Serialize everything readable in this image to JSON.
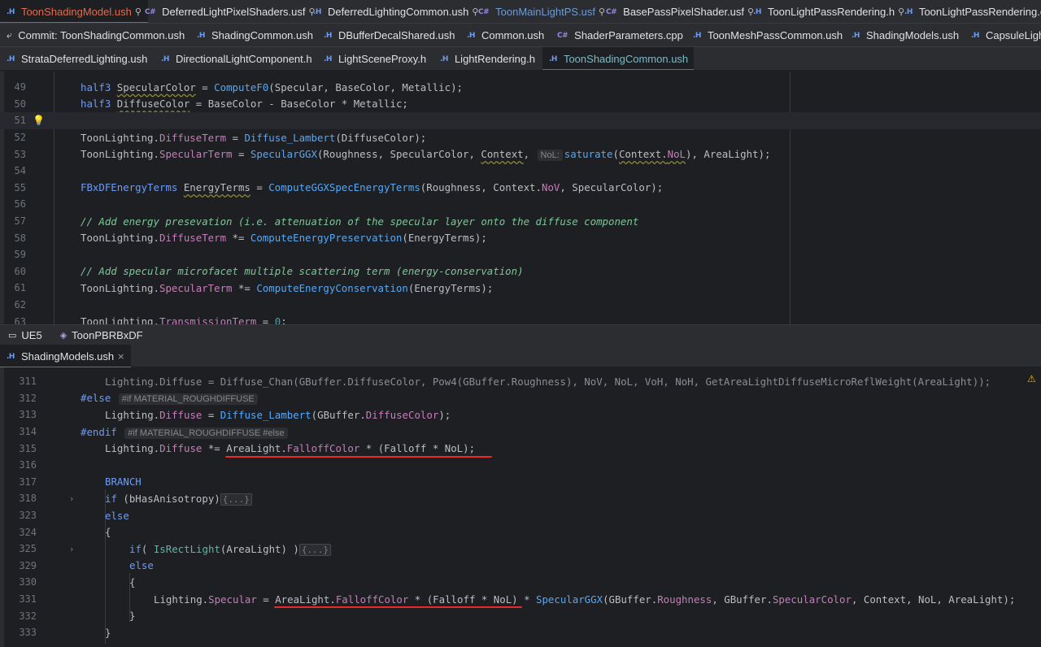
{
  "tabs_row1": [
    {
      "icon": ".H",
      "label": "ToonShadingModel.ush",
      "pinned": true,
      "state": "active"
    },
    {
      "icon": "C#",
      "label": "DeferredLightPixelShaders.usf",
      "pinned": true
    },
    {
      "icon": ".H",
      "label": "DeferredLightingCommon.ush",
      "pinned": true
    },
    {
      "icon": "C#",
      "label": "ToonMainLightPS.usf",
      "pinned": true
    },
    {
      "icon": "C#",
      "label": "BasePassPixelShader.usf",
      "pinned": true
    },
    {
      "icon": ".H",
      "label": "ToonLightPassRendering.h",
      "pinned": true
    },
    {
      "icon": ".H",
      "label": "ToonLightPassRendering.cpp"
    }
  ],
  "tabs_row2": [
    {
      "icon": "commit",
      "label": "Commit: ToonShadingCommon.ush"
    },
    {
      "icon": ".H",
      "label": "ShadingCommon.ush"
    },
    {
      "icon": ".H",
      "label": "DBufferDecalShared.ush"
    },
    {
      "icon": ".H",
      "label": "Common.ush"
    },
    {
      "icon": "C#",
      "label": "ShaderParameters.cpp"
    },
    {
      "icon": ".H",
      "label": "ToonMeshPassCommon.ush"
    },
    {
      "icon": ".H",
      "label": "ShadingModels.ush"
    },
    {
      "icon": ".H",
      "label": "CapsuleLight"
    }
  ],
  "tabs_row3": [
    {
      "icon": ".H",
      "label": "StrataDeferredLighting.ush"
    },
    {
      "icon": ".H",
      "label": "DirectionalLightComponent.h"
    },
    {
      "icon": ".H",
      "label": "LightSceneProxy.h"
    },
    {
      "icon": ".H",
      "label": "LightRendering.h"
    },
    {
      "icon": ".H",
      "label": "ToonShadingCommon.ush"
    }
  ],
  "top_editor": {
    "lines": [
      "49",
      "50",
      "51",
      "52",
      "53",
      "54",
      "55",
      "56",
      "57",
      "58",
      "59",
      "60",
      "61",
      "62",
      "63"
    ]
  },
  "split_bar": {
    "project": "UE5",
    "context": "ToonPBRBxDF"
  },
  "bottom_tab": {
    "icon": ".H",
    "label": "ShadingModels.ush",
    "close": "×"
  },
  "bottom_editor": {
    "lines": [
      "311",
      "312",
      "313",
      "314",
      "315",
      "316",
      "317",
      "318",
      "323",
      "324",
      "325",
      "329",
      "330",
      "331",
      "332",
      "333"
    ]
  },
  "hints": {
    "nol_hint": "NoL:",
    "if_hint_312": "#if MATERIAL_ROUGHDIFFUSE",
    "if_hint_314": "#if MATERIAL_ROUGHDIFFUSE #else",
    "fold": "{...}"
  },
  "colors": {
    "annotation_underline": "#ea2a2a",
    "active_tab_text": "#e06c4f"
  }
}
